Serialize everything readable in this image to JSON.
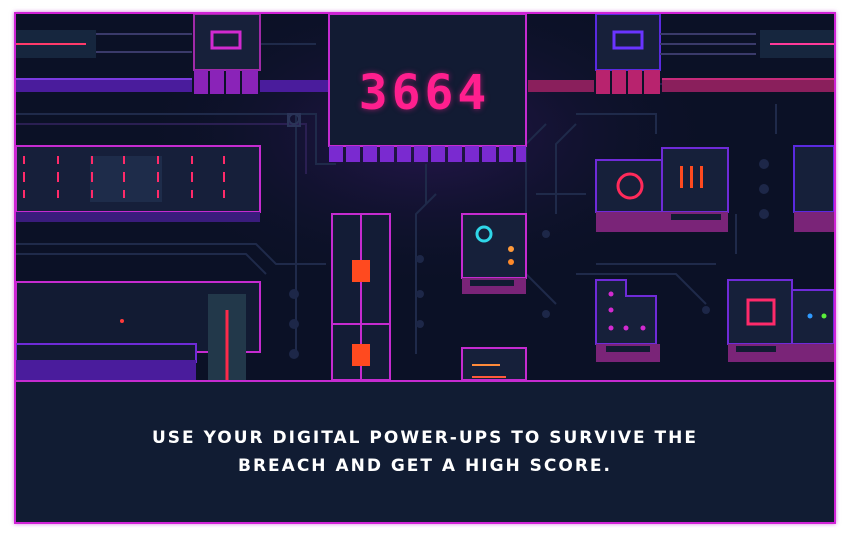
{
  "game": {
    "score": "3664",
    "caption": "USE YOUR DIGITAL POWER-UPS TO SURVIVE THE BREACH AND GET A HIGH SCORE."
  },
  "colors": {
    "background": "#0b1126",
    "panel": "#111c33",
    "neon_pink": "#ff1f8e",
    "neon_magenta": "#d022d6",
    "neon_purple": "#6f2bd8",
    "power_up_orange": "#ff4a1f",
    "cyan": "#2fd6e8"
  },
  "icons": [
    "ring-icon",
    "square-icon",
    "triple-bar-icon",
    "dot-cluster-icon",
    "power-up-block-icon"
  ]
}
